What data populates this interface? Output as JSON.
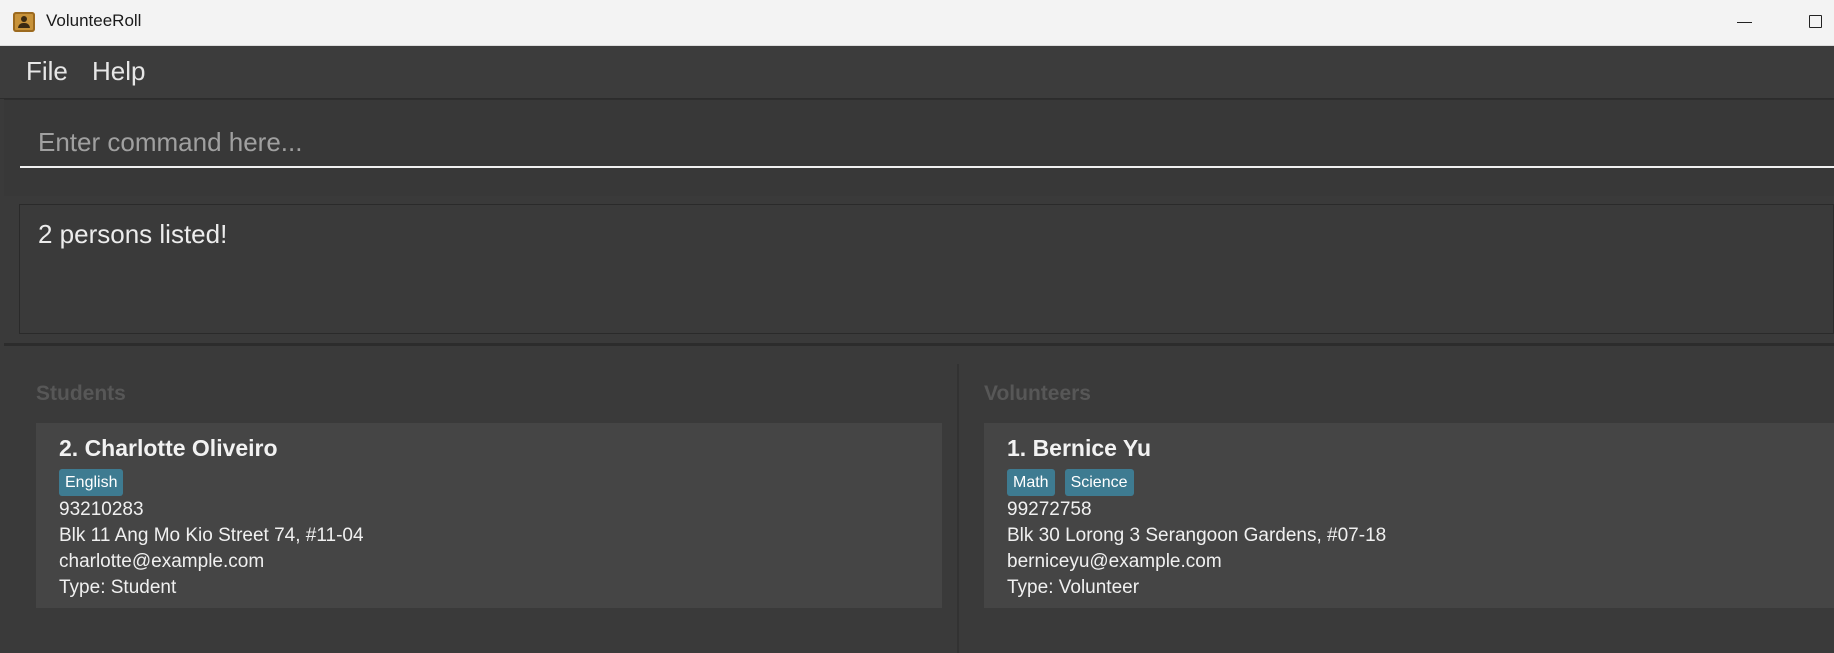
{
  "window": {
    "title": "VolunteeRoll"
  },
  "menu": {
    "file": "File",
    "help": "Help"
  },
  "command": {
    "placeholder": "Enter command here...",
    "value": ""
  },
  "result": {
    "message": "2 persons listed!"
  },
  "students": {
    "title": "Students",
    "cards": [
      {
        "name": "2. Charlotte Oliveiro",
        "tags": [
          "English"
        ],
        "phone": "93210283",
        "address": "Blk 11 Ang Mo Kio Street 74, #11-04",
        "email": "charlotte@example.com",
        "type": "Type: Student"
      }
    ]
  },
  "volunteers": {
    "title": "Volunteers",
    "cards": [
      {
        "name": "1. Bernice Yu",
        "tags": [
          "Math",
          "Science"
        ],
        "phone": "99272758",
        "address": "Blk 30 Lorong 3 Serangoon Gardens, #07-18",
        "email": "berniceyu@example.com",
        "type": "Type: Volunteer"
      }
    ]
  },
  "colors": {
    "tag_background": "#3e7b91",
    "card_background": "#454545",
    "window_background": "#3a3a3a"
  },
  "icons": {
    "app": "person-contact-icon",
    "minimize": "minimize-icon",
    "maximize": "maximize-icon"
  }
}
